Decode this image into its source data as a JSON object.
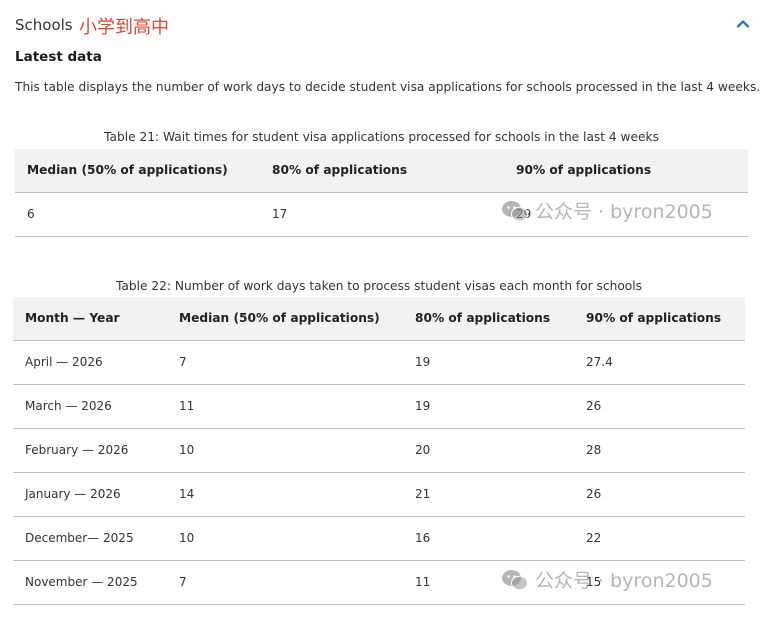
{
  "section": {
    "title": "Schools",
    "cn_annotation": "小学到高中",
    "toggle_icon": "chevron-up-icon"
  },
  "latest_heading": "Latest data",
  "description": "This table displays the number of work days to decide student visa applications for schools processed in the last 4 weeks.",
  "table21": {
    "caption": "Table 21: Wait times for student visa applications processed for schools in the last 4 weeks",
    "headers": [
      "Median (50% of applications)",
      "80% of applications",
      "90% of applications"
    ],
    "rows": [
      [
        "6",
        "17",
        "29"
      ]
    ]
  },
  "table22": {
    "caption": "Table 22: Number of work days taken to process student visas each month for schools",
    "headers": [
      "Month — Year",
      "Median (50% of applications)",
      "80% of applications",
      "90% of applications"
    ],
    "rows": [
      [
        "April — 2026",
        "7",
        "19",
        "27.4"
      ],
      [
        "March — 2026",
        "11",
        "19",
        "26"
      ],
      [
        "February — 2026",
        "10",
        "20",
        "28"
      ],
      [
        "January — 2026",
        "14",
        "21",
        "26"
      ],
      [
        "December— 2025",
        "10",
        "16",
        "22"
      ],
      [
        "November — 2025",
        "7",
        "11",
        "15"
      ]
    ]
  },
  "watermark": {
    "text": "公众号 · byron2005",
    "icon": "wechat-icon"
  },
  "colors": {
    "accent": "#1f6fb5",
    "annotation": "#e2452f",
    "header_bg": "#f2f2f2",
    "border": "#bdbdbd"
  }
}
